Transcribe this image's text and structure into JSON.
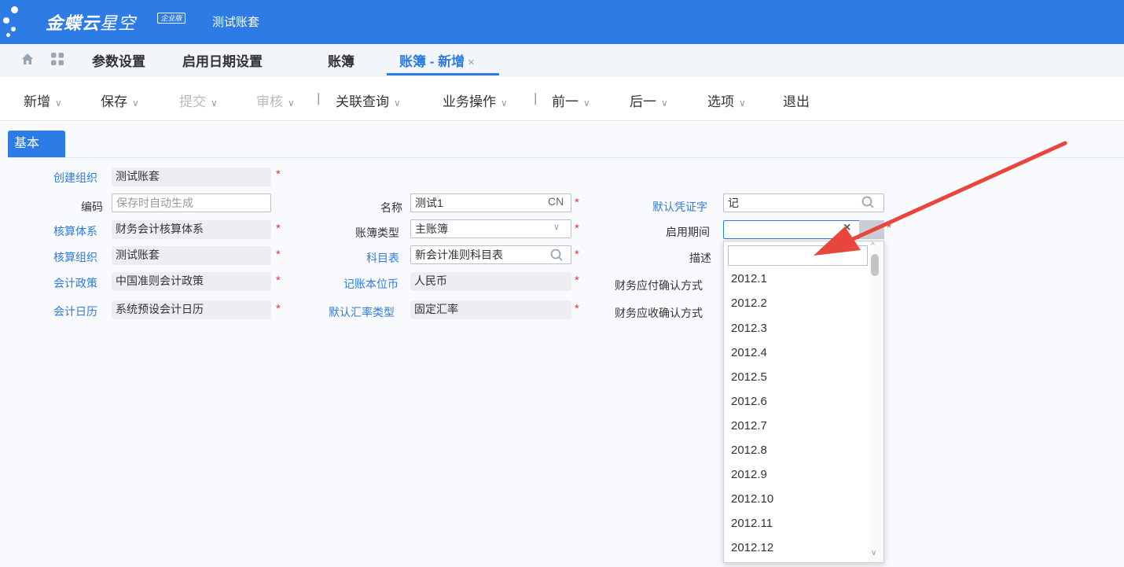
{
  "header": {
    "brand_bold": "金蝶云",
    "brand_light": "星空",
    "edition_badge": "企业版",
    "account_name": "测试账套"
  },
  "tabs": [
    {
      "label": "参数设置"
    },
    {
      "label": "启用日期设置"
    },
    {
      "label": "账簿"
    },
    {
      "label": "账簿 - 新增",
      "close": "×"
    }
  ],
  "toolbar": {
    "new": "新增",
    "save": "保存",
    "submit": "提交",
    "audit": "审核",
    "related_query": "关联查询",
    "business_ops": "业务操作",
    "prev": "前一",
    "next": "后一",
    "options": "选项",
    "exit": "退出",
    "chevron": "∨",
    "sep": "|"
  },
  "basic_tab": "基本",
  "form": {
    "create_org": {
      "label": "创建组织",
      "value": "测试账套"
    },
    "code": {
      "label": "编码",
      "placeholder": "保存时自动生成"
    },
    "accounting_system": {
      "label": "核算体系",
      "value": "财务会计核算体系"
    },
    "accounting_org": {
      "label": "核算组织",
      "value": "测试账套"
    },
    "accounting_policy": {
      "label": "会计政策",
      "value": "中国准则会计政策"
    },
    "accounting_calendar": {
      "label": "会计日历",
      "value": "系统预设会计日历"
    },
    "name": {
      "label": "名称",
      "value": "测试1",
      "suffix": "CN"
    },
    "book_type": {
      "label": "账簿类型",
      "value": "主账簿"
    },
    "account_table": {
      "label": "科目表",
      "value": "新会计准则科目表"
    },
    "currency": {
      "label": "记账本位币",
      "value": "人民币"
    },
    "rate_type": {
      "label": "默认汇率类型",
      "value": "固定汇率"
    },
    "voucher_word": {
      "label": "默认凭证字",
      "value": "记"
    },
    "start_period": {
      "label": "启用期间",
      "value": "",
      "clear": "×"
    },
    "description": {
      "label": "描述"
    },
    "ap_confirm": {
      "label": "财务应付确认方式"
    },
    "ar_confirm": {
      "label": "财务应收确认方式"
    },
    "required_mark": "*"
  },
  "period_dropdown": {
    "search_value": "",
    "options": [
      "2012.1",
      "2012.2",
      "2012.3",
      "2012.4",
      "2012.5",
      "2012.6",
      "2012.7",
      "2012.8",
      "2012.9",
      "2012.10",
      "2012.11",
      "2012.12"
    ]
  },
  "colors": {
    "brand_blue": "#2d7be5",
    "required_red": "#e23b3b",
    "annotation_arrow": "#e8453c"
  },
  "icons": [
    "home-icon",
    "apps-icon",
    "search-icon",
    "clear-icon",
    "dropdown-caret-icon",
    "annotation-arrow"
  ]
}
